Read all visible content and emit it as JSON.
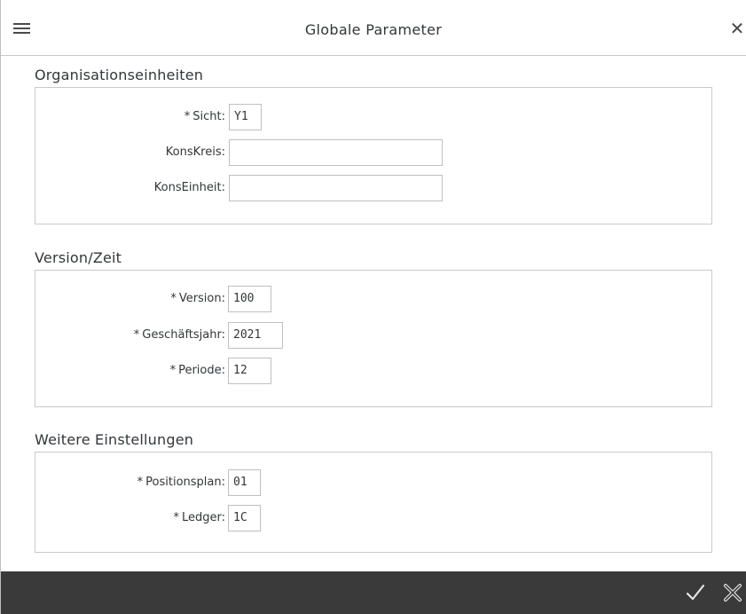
{
  "dialog": {
    "title": "Globale Parameter",
    "close_glyph": "✕"
  },
  "sections": [
    {
      "title": "Organisationseinheiten",
      "fields": [
        {
          "label": "Sicht:",
          "required": true,
          "value": "Y1"
        },
        {
          "label": "KonsKreis:",
          "required": false,
          "value": ""
        },
        {
          "label": "KonsEinheit:",
          "required": false,
          "value": ""
        }
      ]
    },
    {
      "title": "Version/Zeit",
      "fields": [
        {
          "label": "Version:",
          "required": true,
          "value": "100"
        },
        {
          "label": "Geschäftsjahr:",
          "required": true,
          "value": "2021"
        },
        {
          "label": "Periode:",
          "required": true,
          "value": "12"
        }
      ]
    },
    {
      "title": "Weitere Einstellungen",
      "fields": [
        {
          "label": "Positionsplan:",
          "required": true,
          "value": "01"
        },
        {
          "label": "Ledger:",
          "required": true,
          "value": "1C"
        }
      ]
    }
  ],
  "required_marker": "*",
  "footer": {
    "confirm_icon": "checkmark-icon",
    "cancel_icon": "cancel-icon"
  },
  "colors": {
    "footer_bg": "#3a3a3a",
    "border": "#c9c9c9",
    "text": "#32363a"
  }
}
